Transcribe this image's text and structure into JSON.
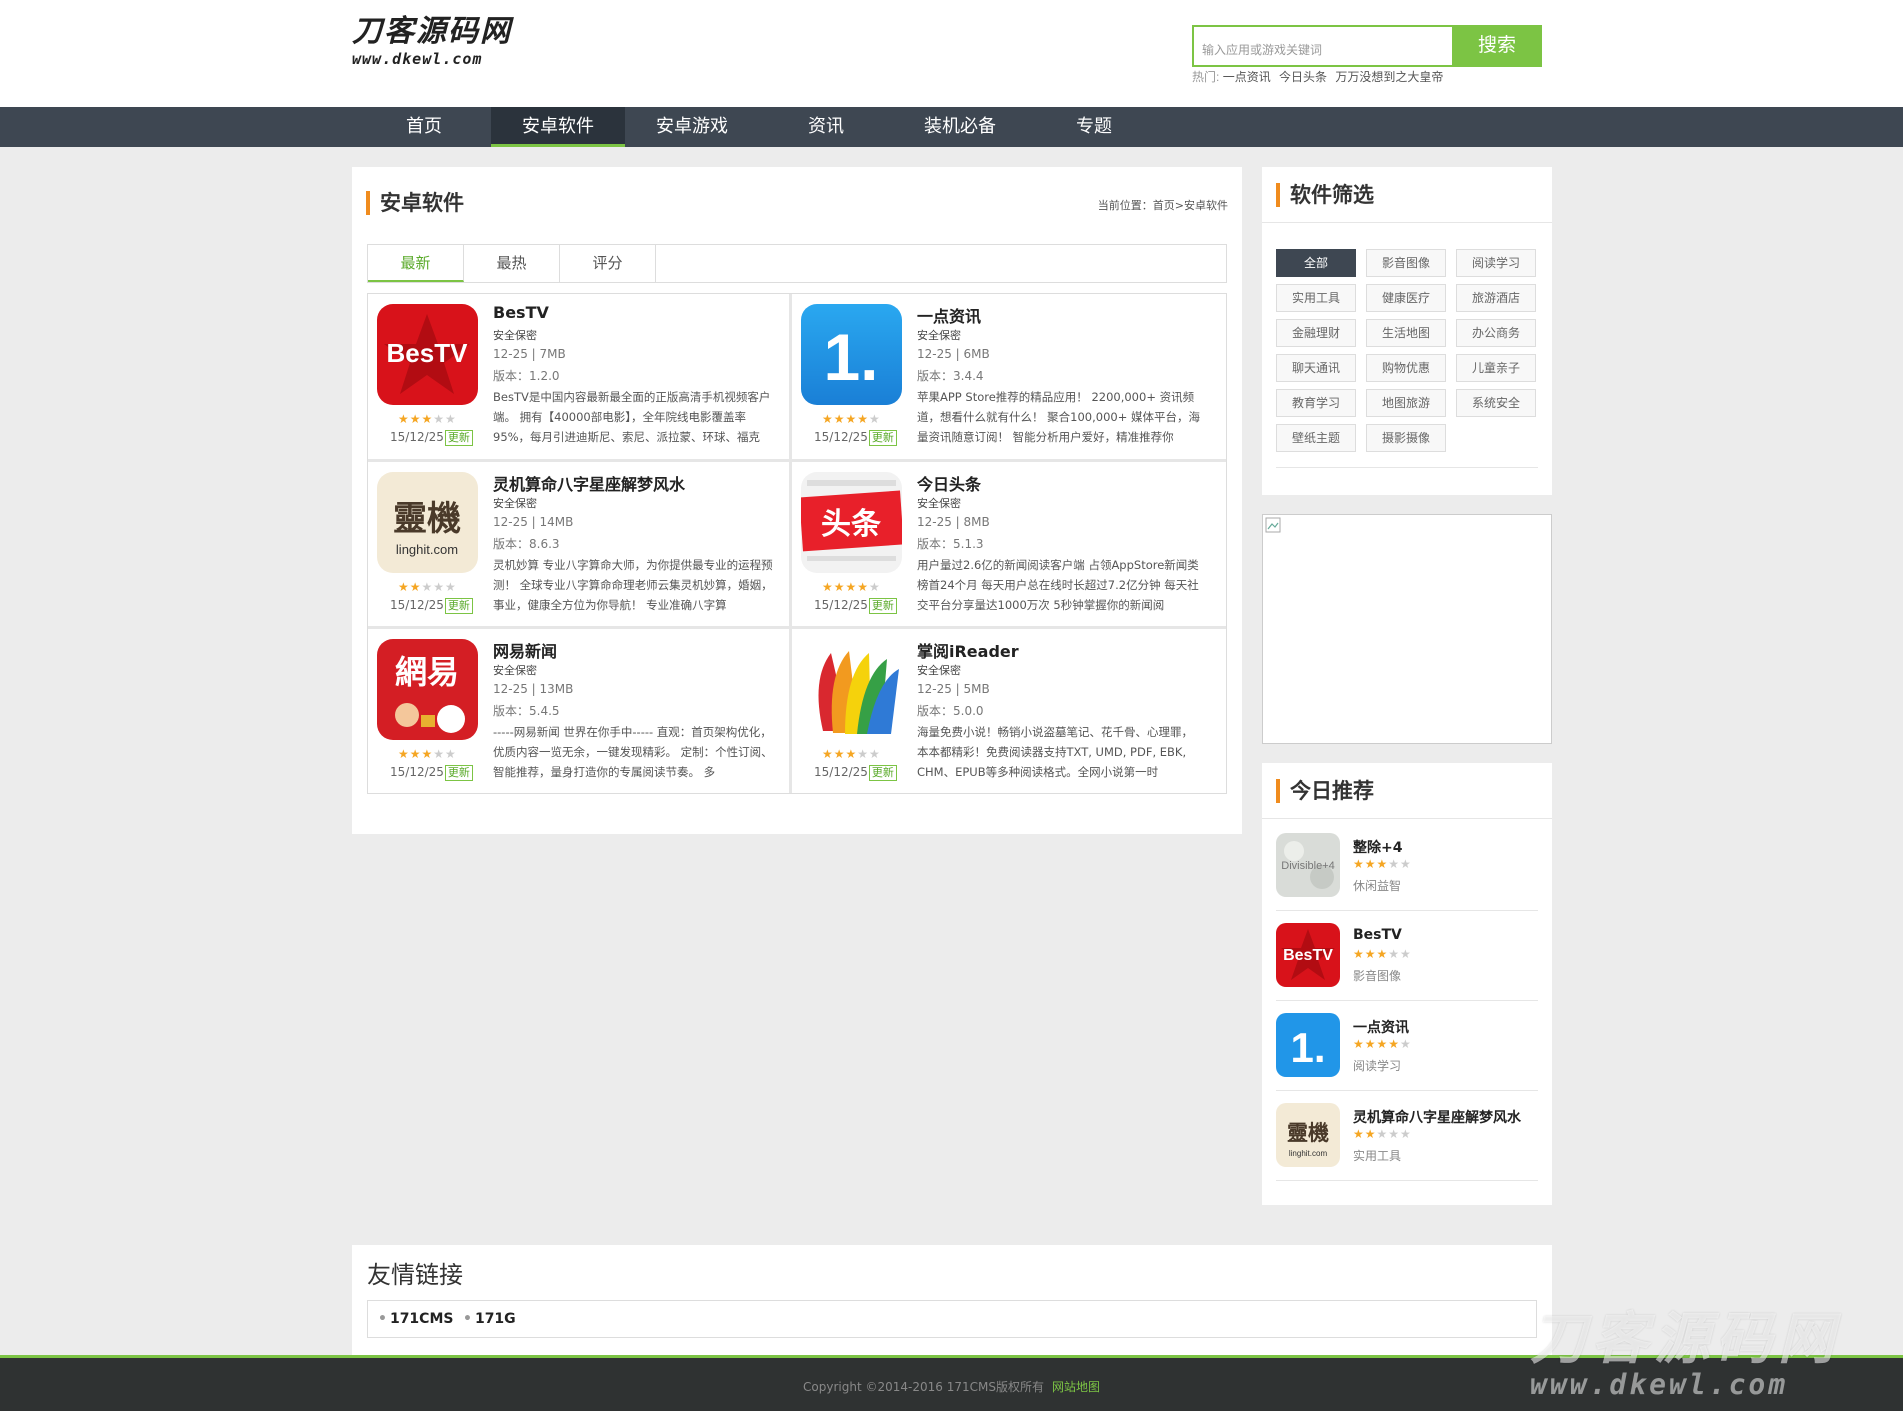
{
  "logo": {
    "line1": "刀客源码网",
    "line2": "www.dkewl.com"
  },
  "search": {
    "placeholder": "输入应用或游戏关键词",
    "button": "搜索"
  },
  "hot": {
    "label": "热门:",
    "links": [
      "一点资讯",
      "今日头条",
      "万万没想到之大皇帝"
    ]
  },
  "nav": [
    "首页",
    "安卓软件",
    "安卓游戏",
    "资讯",
    "装机必备",
    "专题"
  ],
  "nav_active": "安卓软件",
  "main": {
    "title": "安卓软件",
    "breadcrumb": "当前位置：首页>安卓软件",
    "tabs": [
      "最新",
      "最热",
      "评分"
    ],
    "apps": [
      {
        "name": "BesTV",
        "safe": "安全保密",
        "meta": "12-25 | 7MB",
        "version": "版本：1.2.0",
        "desc": "BesTV是中国内容最新最全面的正版高清手机视频客户端。 拥有【40000部电影】，全年院线电影覆盖率95%，每月引进迪斯尼、索尼、派拉蒙、环球、福克",
        "rating": 3,
        "date": "15/12/25",
        "badge": "更新",
        "icon": "bestv-icon"
      },
      {
        "name": "一点资讯",
        "safe": "安全保密",
        "meta": "12-25 | 6MB",
        "version": "版本：3.4.4",
        "desc": "苹果APP Store推荐的精品应用！ 2200,000+ 资讯频道，想看什么就有什么！ 聚合100,000+ 媒体平台，海量资讯随意订阅！ 智能分析用户爱好，精准推荐你",
        "rating": 4,
        "date": "15/12/25",
        "badge": "更新",
        "icon": "yidian-icon"
      },
      {
        "name": "灵机算命八字星座解梦风水",
        "safe": "安全保密",
        "meta": "12-25 | 14MB",
        "version": "版本：8.6.3",
        "desc": "灵机妙算 专业八字算命大师，为你提供最专业的运程预测！ 全球专业八字算命命理老师云集灵机妙算，婚姻，事业，健康全方位为你导航！ 专业准确八字算",
        "rating": 2,
        "date": "15/12/25",
        "badge": "更新",
        "icon": "lingji-icon"
      },
      {
        "name": "今日头条",
        "safe": "安全保密",
        "meta": "12-25 | 8MB",
        "version": "版本：5.1.3",
        "desc": "用户量过2.6亿的新闻阅读客户端 占领AppStore新闻类榜首24个月 每天用户总在线时长超过7.2亿分钟 每天社交平台分享量达1000万次 5秒钟掌握你的新闻阅",
        "rating": 4,
        "date": "15/12/25",
        "badge": "更新",
        "icon": "toutiao-icon"
      },
      {
        "name": "网易新闻",
        "safe": "安全保密",
        "meta": "12-25 | 13MB",
        "version": "版本：5.4.5",
        "desc": "-----网易新闻 世界在你手中----- 直观：首页架构优化，优质内容一览无余，一键发现精彩。 定制：个性订阅、智能推荐，量身打造你的专属阅读节奏。 多",
        "rating": 3,
        "date": "15/12/25",
        "badge": "更新",
        "icon": "netease-icon"
      },
      {
        "name": "掌阅iReader",
        "safe": "安全保密",
        "meta": "12-25 | 5MB",
        "version": "版本：5.0.0",
        "desc": "海量免费小说！畅销小说盗墓笔记、花千骨、心理罪，本本都精彩！免费阅读器支持TXT, UMD, PDF, EBK, CHM、EPUB等多种阅读格式。全网小说第一时",
        "rating": 3,
        "date": "15/12/25",
        "badge": "更新",
        "icon": "ireader-icon"
      }
    ]
  },
  "filter": {
    "title": "软件筛选",
    "items": [
      "全部",
      "影音图像",
      "阅读学习",
      "实用工具",
      "健康医疗",
      "旅游酒店",
      "金融理财",
      "生活地图",
      "办公商务",
      "聊天通讯",
      "购物优惠",
      "儿童亲子",
      "教育学习",
      "地图旅游",
      "系统安全",
      "壁纸主题",
      "摄影摄像"
    ],
    "active": "全部"
  },
  "recommend": {
    "title": "今日推荐",
    "items": [
      {
        "name": "整除+4",
        "rating": 3,
        "category": "休闲益智",
        "icon": "divisible-icon",
        "icon_text": "Divisible+4"
      },
      {
        "name": "BesTV",
        "rating": 3,
        "category": "影音图像",
        "icon": "bestv-icon"
      },
      {
        "name": "一点资讯",
        "rating": 4,
        "category": "阅读学习",
        "icon": "yidian-icon"
      },
      {
        "name": "灵机算命八字星座解梦风水",
        "rating": 2,
        "category": "实用工具",
        "icon": "lingji-icon"
      }
    ]
  },
  "links": {
    "title": "友情链接",
    "items": [
      "171CMS",
      "171G"
    ]
  },
  "footer": {
    "copyright": "Copyright ©2014-2016 171CMS版权所有",
    "sitemap": "网站地图"
  },
  "watermark": {
    "line1": "刀客源码网",
    "line2": "www.dkewl.com"
  },
  "icon_text": {
    "bestv": "BesTV",
    "yidian": "1.",
    "lingji_top": "靈機",
    "lingji_bottom": "linghit.com",
    "toutiao": "头条",
    "netease": "網易"
  },
  "colors": {
    "accent": "#7cc444",
    "nav_bg": "#3e4752",
    "title_marker": "#f08c1e",
    "star": "#f5a623"
  }
}
